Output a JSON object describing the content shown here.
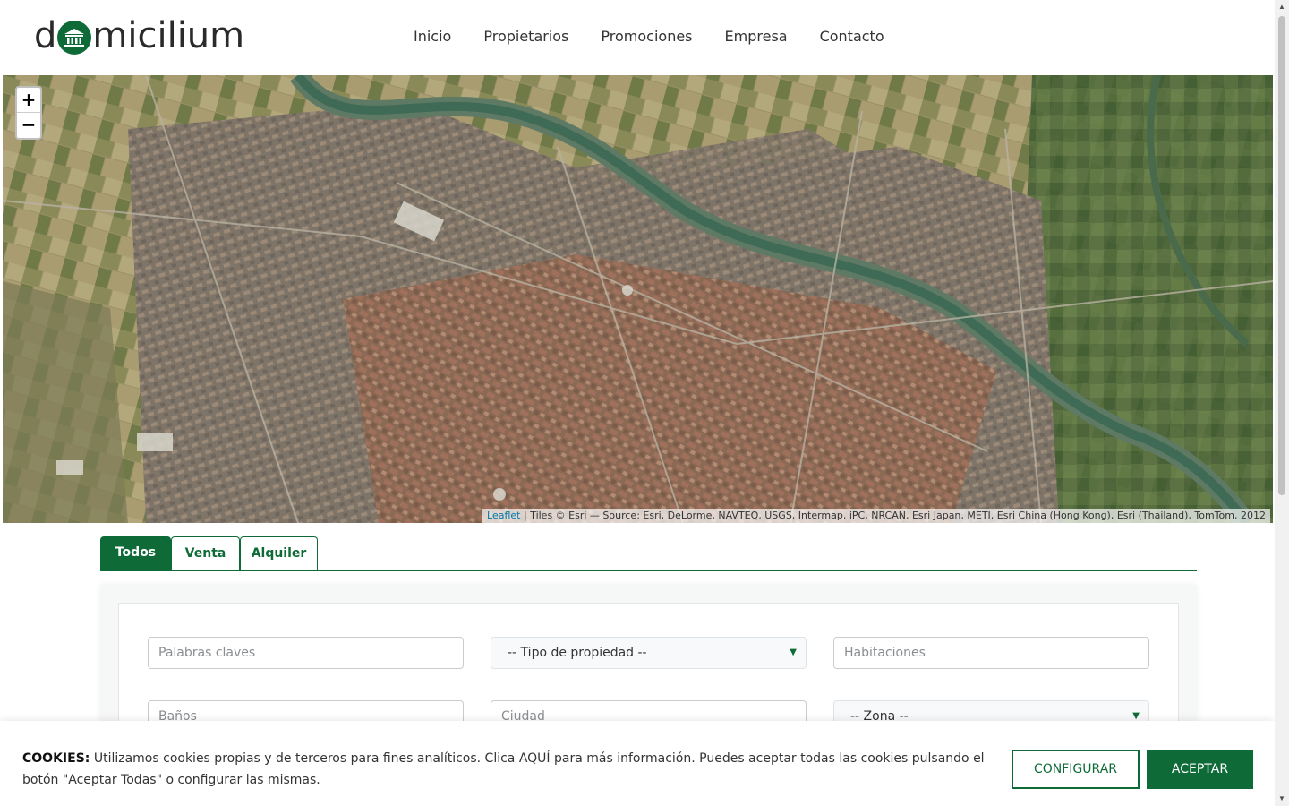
{
  "brand": {
    "prefix": "d",
    "suffix": "micilium",
    "color": "#0e6b38"
  },
  "nav": [
    "Inicio",
    "Propietarios",
    "Promociones",
    "Empresa",
    "Contacto"
  ],
  "map": {
    "zoom_in": "+",
    "zoom_out": "−",
    "attribution_link": "Leaflet",
    "attribution_text": " | Tiles © Esri — Source: Esri, DeLorme, NAVTEQ, USGS, Intermap, iPC, NRCAN, Esri Japan, METI, Esri China (Hong Kong), Esri (Thailand), TomTom, 2012"
  },
  "tabs": [
    "Todos",
    "Venta",
    "Alquiler"
  ],
  "search": {
    "keywords_placeholder": "Palabras claves",
    "property_type": "-- Tipo de propiedad --",
    "rooms_placeholder": "Habitaciones",
    "baths_placeholder": "Baños",
    "city_placeholder": "Ciudad",
    "zone": "-- Zona --"
  },
  "cookies": {
    "label": "COOKIES:",
    "text": " Utilizamos cookies propias y de terceros para fines analíticos. Clica AQUÍ para más información. Puedes aceptar todas las cookies pulsando el botón \"Aceptar Todas\" o configurar las mismas.",
    "configure": "CONFIGURAR",
    "accept": "ACEPTAR"
  },
  "icons": {
    "logo_mark": "bank-icon",
    "select_arrow": "chevron-down-icon"
  }
}
